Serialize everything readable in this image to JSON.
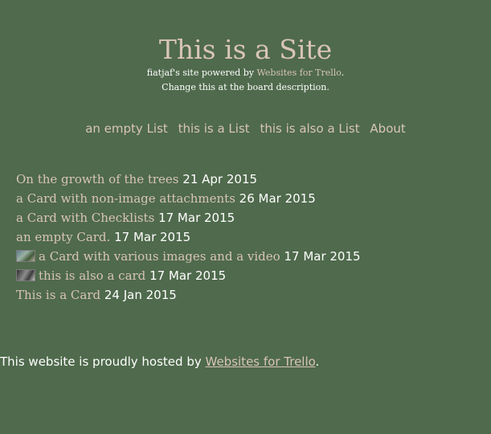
{
  "header": {
    "title": "This is a Site",
    "powered_prefix": "fiatjaf's site powered by ",
    "powered_link": "Websites for Trello",
    "powered_suffix": ".",
    "change_note": "Change this at the board description."
  },
  "nav": {
    "items": [
      {
        "label": "an empty List"
      },
      {
        "label": "this is a List"
      },
      {
        "label": "this is also a List"
      },
      {
        "label": "About"
      }
    ]
  },
  "cards": [
    {
      "title": "On the growth of the trees",
      "date": "21 Apr 2015"
    },
    {
      "title": "a Card with non-image attachments",
      "date": "26 Mar 2015"
    },
    {
      "title": "a Card with Checklists",
      "date": "17 Mar 2015"
    },
    {
      "title": "an empty Card.",
      "date": "17 Mar 2015"
    },
    {
      "title": "a Card with various images and a video",
      "date": "17 Mar 2015"
    },
    {
      "title": "this is also a card",
      "date": "17 Mar 2015"
    },
    {
      "title": "This is a Card",
      "date": "24 Jan 2015"
    }
  ],
  "footer": {
    "prefix": "This website is proudly hosted by ",
    "link": "Websites for Trello",
    "suffix": "."
  },
  "colors": {
    "background": "#4f6a4c",
    "link": "#d9c4b9",
    "text": "#ffffff"
  }
}
